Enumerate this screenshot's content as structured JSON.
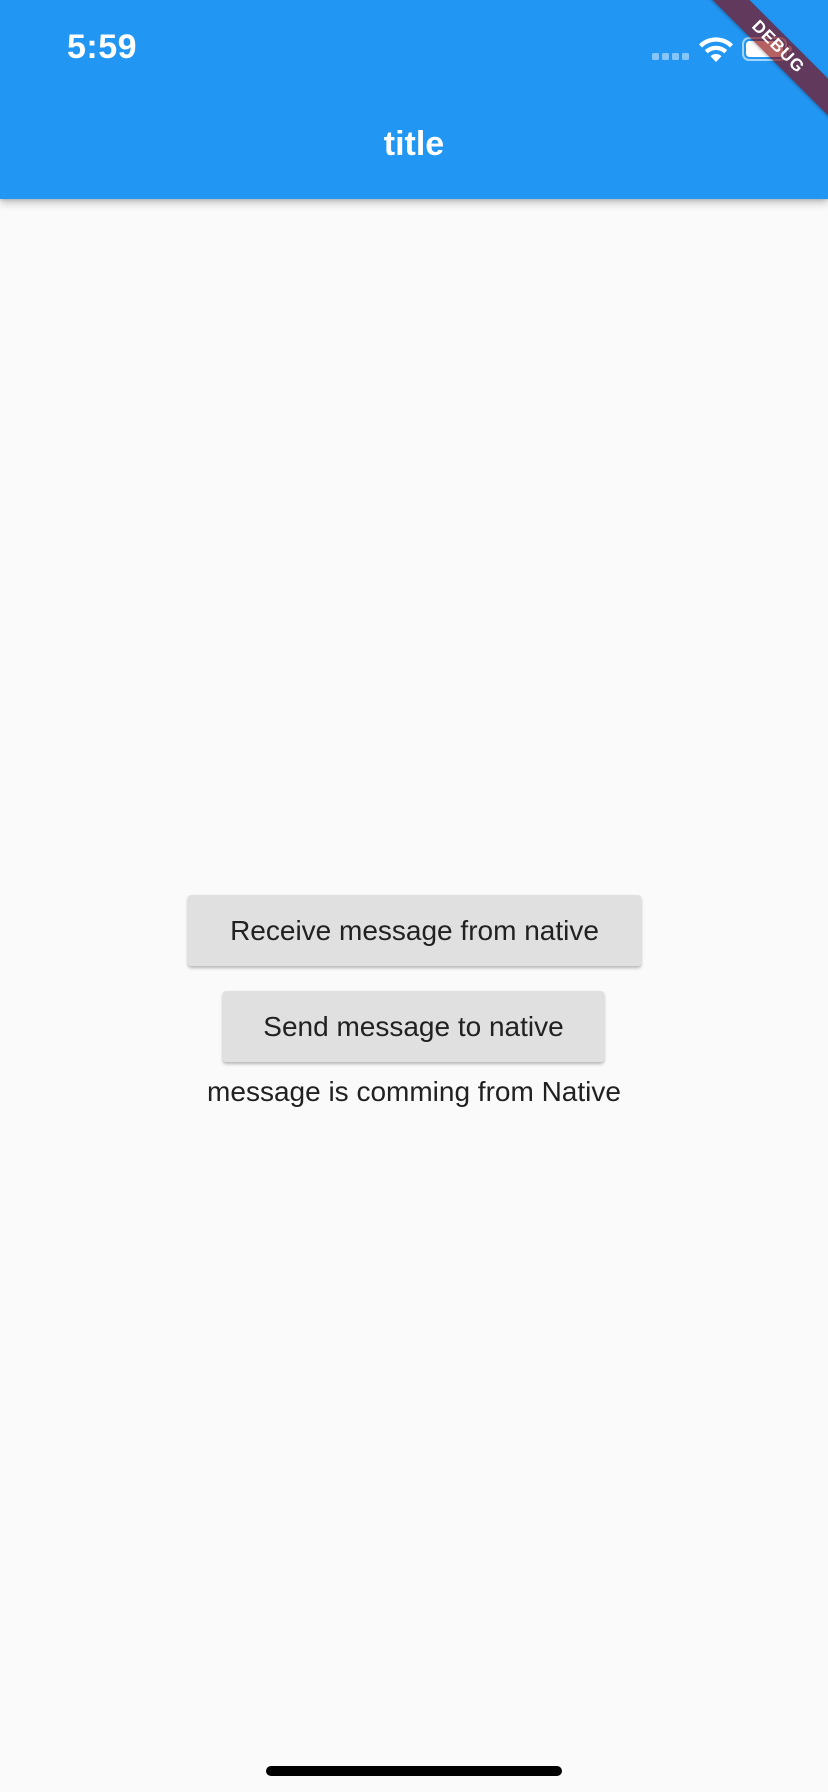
{
  "status_bar": {
    "time": "5:59",
    "icons": [
      "signal-icon",
      "wifi-icon",
      "battery-icon"
    ]
  },
  "app_bar": {
    "title": "title",
    "color": "#2196f3"
  },
  "debug_banner": {
    "label": "DEBUG"
  },
  "buttons": {
    "receive_label": "Receive message from native",
    "send_label": "Send message to native"
  },
  "message_text": "message is comming from Native",
  "colors": {
    "background": "#fafafa",
    "button_bg": "#e0e0e0",
    "text": "#212121"
  }
}
